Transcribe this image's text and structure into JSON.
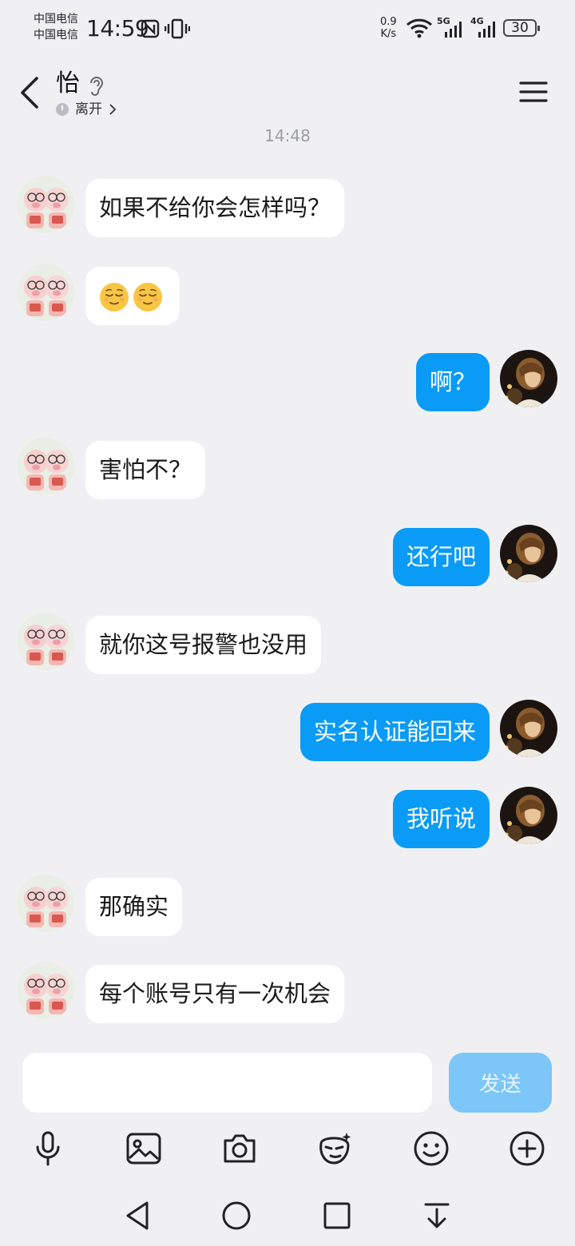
{
  "status_bar": {
    "carrier_1": "中国电信",
    "carrier_2": "中国电信",
    "time": "14:59",
    "net_speed_value": "0.9",
    "net_speed_unit": "K/s",
    "sim1_type": "5G",
    "sim2_type": "4G",
    "battery": "30",
    "icons": [
      "nfc-icon",
      "vibrate-icon",
      "wifi-icon",
      "signal-5g-icon",
      "signal-4g-icon",
      "battery-icon"
    ]
  },
  "header": {
    "contact_name": "怡",
    "presence": "离开",
    "icons": [
      "back-arrow-icon",
      "ear-icon",
      "menu-icon"
    ]
  },
  "chat": {
    "timestamp": "14:48",
    "messages": [
      {
        "side": "in",
        "text": "如果不给你会怎样吗？"
      },
      {
        "side": "in",
        "text": "",
        "emoji": [
          "relieved-face",
          "relieved-face"
        ]
      },
      {
        "side": "out",
        "text": "啊？"
      },
      {
        "side": "in",
        "text": "害怕不？"
      },
      {
        "side": "out",
        "text": "还行吧"
      },
      {
        "side": "in",
        "text": "就你这号报警也没用"
      },
      {
        "side": "out",
        "text": "实名认证能回来"
      },
      {
        "side": "out",
        "text": "我听说"
      },
      {
        "side": "in",
        "text": "那确实"
      },
      {
        "side": "in",
        "text": "每个账号只有一次机会"
      }
    ]
  },
  "input": {
    "value": "",
    "send_label": "发送"
  },
  "toolbar": {
    "items": [
      "microphone-icon",
      "image-icon",
      "camera-icon",
      "sticker-face-icon",
      "emoji-icon",
      "plus-icon"
    ]
  },
  "nav_bar": {
    "items": [
      "nav-back-icon",
      "nav-home-icon",
      "nav-recents-icon",
      "nav-notification-icon"
    ]
  },
  "colors": {
    "background": "#f0f0f3",
    "outgoing_bubble": "#0a9bf7",
    "incoming_bubble": "#ffffff",
    "send_button": "#7cc6f8"
  }
}
